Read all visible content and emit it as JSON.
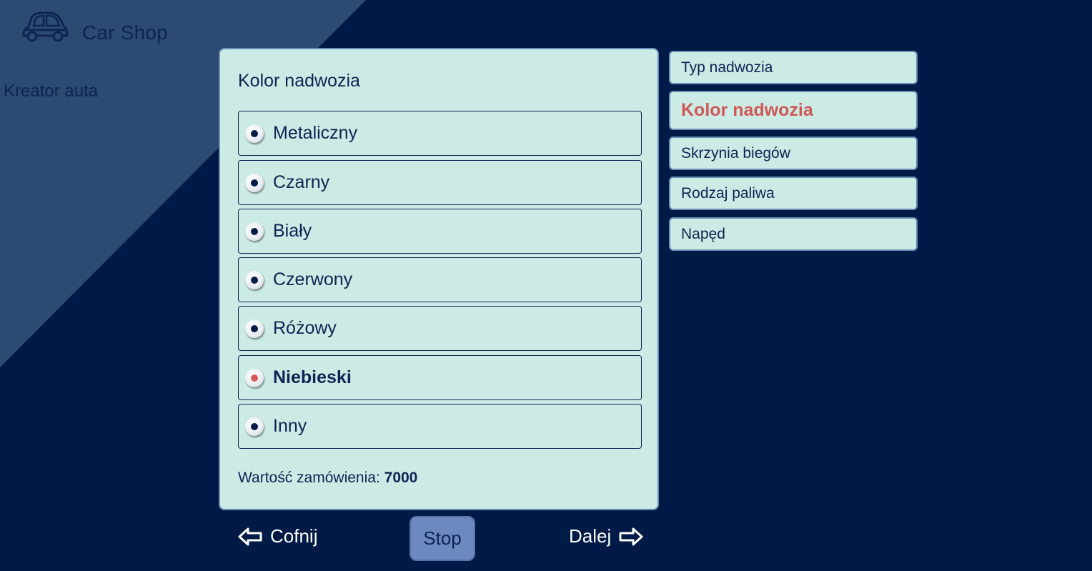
{
  "app": {
    "brand": "Car Shop",
    "subtitle": "Kreator auta"
  },
  "panel": {
    "title": "Kolor nadwozia",
    "options": [
      {
        "label": "Metaliczny",
        "selected": false
      },
      {
        "label": "Czarny",
        "selected": false
      },
      {
        "label": "Biały",
        "selected": false
      },
      {
        "label": "Czerwony",
        "selected": false
      },
      {
        "label": "Różowy",
        "selected": false
      },
      {
        "label": "Niebieski",
        "selected": true
      },
      {
        "label": "Inny",
        "selected": false
      }
    ],
    "total_label": "Wartość zamówienia:",
    "total_value": "7000"
  },
  "steps": [
    {
      "label": "Typ nadwozia",
      "active": false
    },
    {
      "label": "Kolor nadwozia",
      "active": true
    },
    {
      "label": "Skrzynia biegów",
      "active": false
    },
    {
      "label": "Rodzaj paliwa",
      "active": false
    },
    {
      "label": "Napęd",
      "active": false
    }
  ],
  "nav": {
    "back_label": "Cofnij",
    "stop_label": "Stop",
    "next_label": "Dalej"
  },
  "icons": {
    "logo": "car-icon",
    "back": "arrow-left-icon",
    "next": "arrow-right-icon"
  },
  "colors": {
    "background": "#001a47",
    "diagonal": "#2d4a72",
    "panel": "#ccebe5",
    "accent": "#d05757",
    "stop_button": "#6e89bf"
  }
}
